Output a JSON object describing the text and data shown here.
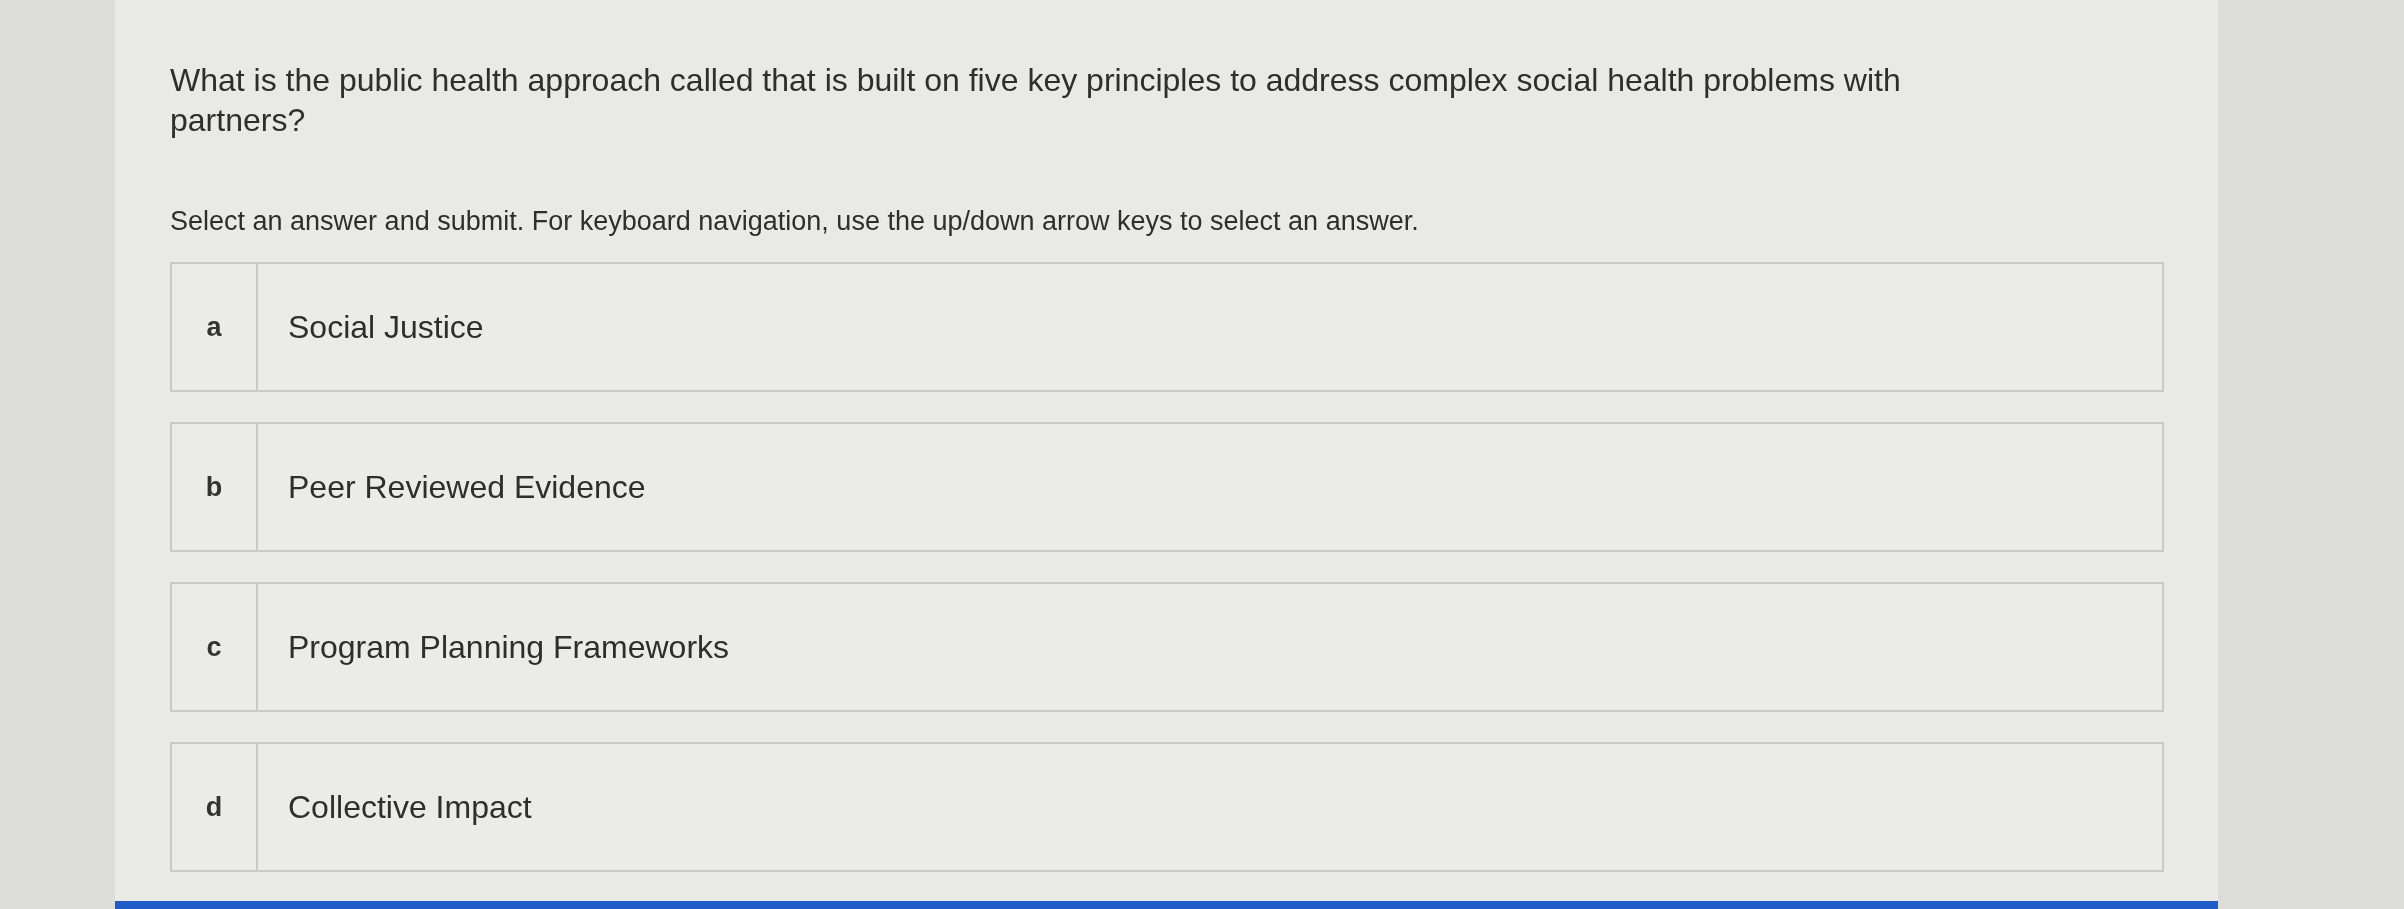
{
  "question": "What is the public health approach called that is built on five key principles to address complex social health problems with partners?",
  "instructions": "Select an answer and submit. For keyboard navigation, use the up/down arrow keys to select an answer.",
  "options": [
    {
      "letter": "a",
      "text": "Social Justice",
      "selected": false
    },
    {
      "letter": "b",
      "text": "Peer Reviewed Evidence",
      "selected": false
    },
    {
      "letter": "c",
      "text": "Program Planning Frameworks",
      "selected": false
    },
    {
      "letter": "d",
      "text": "Collective Impact",
      "selected": false
    }
  ]
}
